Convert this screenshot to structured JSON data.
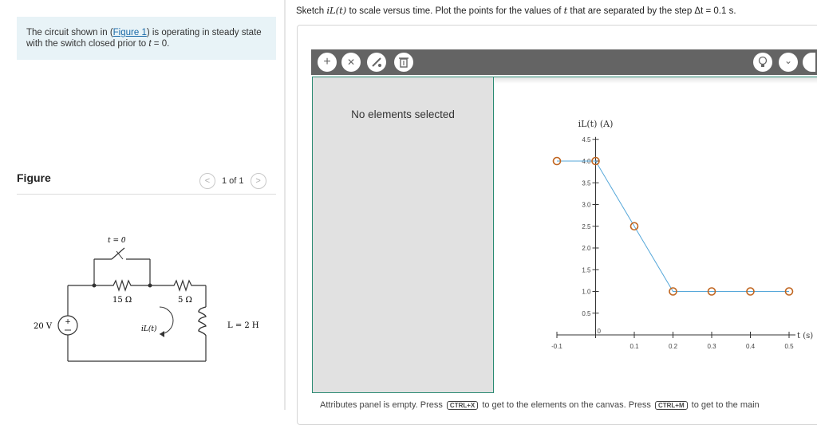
{
  "problem": {
    "text_before": "The circuit shown in (",
    "figure_link": "Figure 1",
    "text_after": ") is operating in steady state with the switch closed prior to ",
    "t_symbol": "t",
    "t_equals": " = 0."
  },
  "figure_panel": {
    "title": "Figure",
    "pager": "1 of 1",
    "prev_icon": "<",
    "next_icon": ">"
  },
  "circuit": {
    "switch_label": "t = 0",
    "source_label": "20 V",
    "plus_sign": "+",
    "r1_label": "15 Ω",
    "r2_label": "5 Ω",
    "inductor_label": "L = 2 H",
    "current_label": "iL(t)"
  },
  "task": {
    "prefix": "Sketch ",
    "func": "iL(t)",
    "middle": " to scale versus time. Plot the points for the values of ",
    "t_symbol": "t",
    "suffix": " that are separated by the step Δt = 0.1 s."
  },
  "toolbar": {
    "add_icon": "+",
    "delete_icon": "✕",
    "hint_icon": "lightbulb-icon",
    "chevron_icon": "⌄"
  },
  "panel": {
    "no_elements": "No elements selected"
  },
  "attributes": {
    "text_before": "Attributes panel is empty. Press ",
    "key1": "CTRL+X",
    "text_middle": " to get to the elements on the canvas. Press ",
    "key2": "CTRL+M",
    "text_after": " to get to the main"
  },
  "chart_data": {
    "type": "line",
    "ylabel": "iL(t) (A)",
    "xlabel": "t (s)",
    "xlim": [
      -0.1,
      0.5
    ],
    "ylim": [
      0,
      4.5
    ],
    "x_ticks": [
      "-0.1",
      "0",
      "0.1",
      "0.2",
      "0.3",
      "0.4",
      "0.5"
    ],
    "y_ticks": [
      "0.5",
      "1.0",
      "1.5",
      "2.0",
      "2.5",
      "3.0",
      "3.5",
      "4.0",
      "4.5"
    ],
    "series": [
      {
        "x": [
          -0.1,
          0,
          0.1,
          0.2,
          0.3,
          0.4,
          0.5
        ],
        "y": [
          4.0,
          4.0,
          2.5,
          1.0,
          1.0,
          1.0,
          1.0
        ]
      }
    ],
    "line_color": "#55a7d9",
    "marker_color": "#c0651f"
  }
}
